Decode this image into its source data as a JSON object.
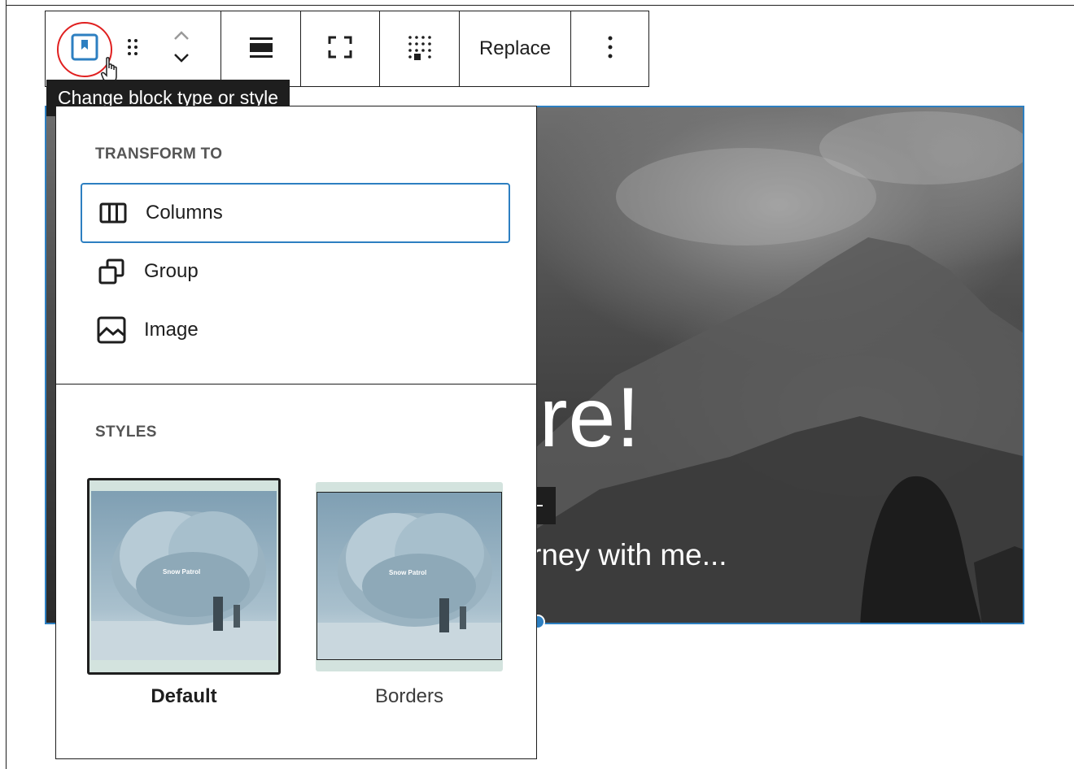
{
  "toolbar": {
    "replace_label": "Replace"
  },
  "tooltip": {
    "text": "Change block type or style"
  },
  "cover": {
    "title": "ore!",
    "subtitle": "rney with me..."
  },
  "popover": {
    "transform_heading": "TRANSFORM TO",
    "transform_items": [
      {
        "label": "Columns",
        "icon": "columns-icon"
      },
      {
        "label": "Group",
        "icon": "group-icon"
      },
      {
        "label": "Image",
        "icon": "image-icon"
      }
    ],
    "styles_heading": "STYLES",
    "styles": [
      {
        "label": "Default",
        "selected": true,
        "thumb_text": "Snow Patrol"
      },
      {
        "label": "Borders",
        "selected": false,
        "thumb_text": "Snow Patrol"
      }
    ]
  },
  "colors": {
    "accent": "#2d7fc1",
    "highlight_ring": "#e02020",
    "dark": "#1e1e1e"
  }
}
